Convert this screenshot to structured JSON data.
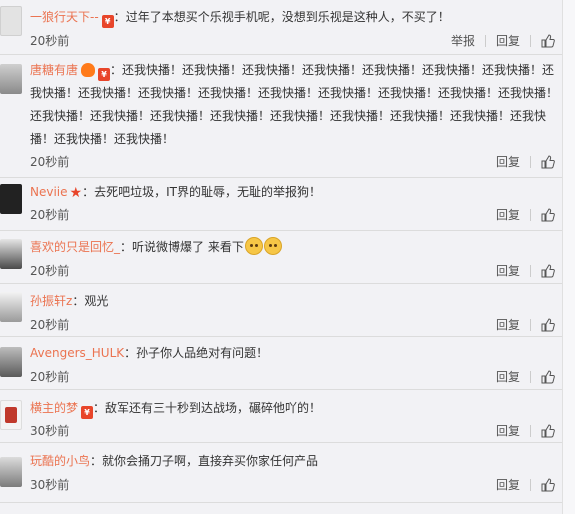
{
  "comments": [
    {
      "user": "一狼行天下--",
      "badge": "¥",
      "sep": "：",
      "content": "过年了本想买个乐视手机呢，没想到乐视是这种人，不买了！",
      "time": "20秒前",
      "report": "举报",
      "reply": "回复"
    },
    {
      "user": "唐糖有唐",
      "badge": "¥",
      "sep": "：",
      "content": "还我快播！还我快播！还我快播！还我快播！还我快播！还我快播！还我快播！还我快播！还我快播！还我快播！还我快播！还我快播！还我快播！还我快播！还我快播！还我快播！还我快播！还我快播！还我快播！还我快播！还我快播！还我快播！还我快播！还我快播！还我快播！还我快播！还我快播！",
      "time": "20秒前",
      "reply": "回复"
    },
    {
      "user": "Neviie",
      "sep": "：",
      "content": "去死吧垃圾，IT界的耻辱，无耻的举报狗！",
      "time": "20秒前",
      "reply": "回复"
    },
    {
      "user": "喜欢的只是回忆_",
      "sep": "：",
      "content": "听说微博爆了 来看下",
      "time": "20秒前",
      "reply": "回复"
    },
    {
      "user": "孙振轩z",
      "sep": "：",
      "content": "观光",
      "time": "20秒前",
      "reply": "回复"
    },
    {
      "user": "Avengers_HULK",
      "sep": "：",
      "content": "孙子你人品绝对有问题！",
      "time": "20秒前",
      "reply": "回复"
    },
    {
      "user": "横主的梦",
      "badge": "¥",
      "sep": "：",
      "content": "敌军还有三十秒到达战场，碾碎他吖的！",
      "time": "30秒前",
      "reply": "回复"
    },
    {
      "user": "玩酷的小鸟",
      "sep": "：",
      "content": "就你会捅刀子啊，直接弃买你家任何产品",
      "time": "30秒前",
      "reply": "回复"
    }
  ]
}
